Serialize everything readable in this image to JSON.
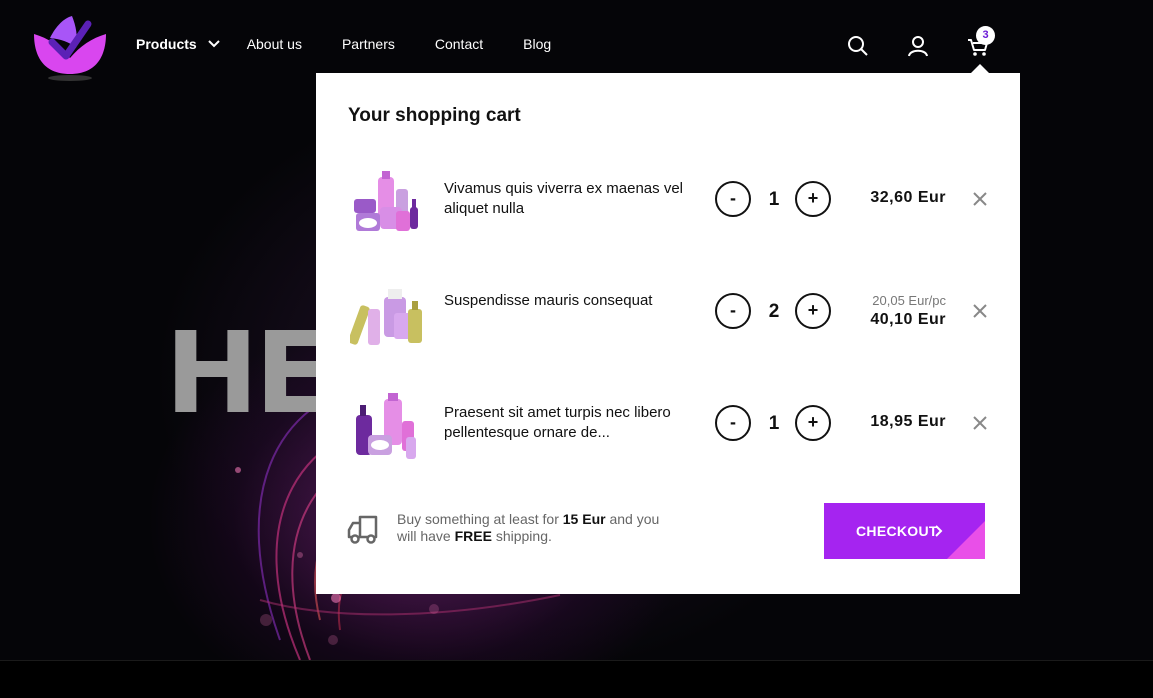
{
  "nav": {
    "items": [
      {
        "label": "Products"
      },
      {
        "label": "About us"
      },
      {
        "label": "Partners"
      },
      {
        "label": "Contact"
      },
      {
        "label": "Blog"
      }
    ]
  },
  "header": {
    "search_icon": "search-icon",
    "user_icon": "user-icon",
    "cart_icon": "cart-icon",
    "cart_count": "3"
  },
  "hero": {
    "text": "HE"
  },
  "cart": {
    "title": "Your shopping cart",
    "minus_label": "-",
    "plus_label": "+",
    "items": [
      {
        "name": "Vivamus quis viverra ex maenas vel aliquet nulla",
        "qty": "1",
        "unit_price": "",
        "price": "32,60 Eur"
      },
      {
        "name": "Suspendisse mauris consequat",
        "qty": "2",
        "unit_price": "20,05 Eur/pc",
        "price": "40,10 Eur"
      },
      {
        "name": "Praesent sit amet turpis nec libero pellentesque ornare de...",
        "qty": "1",
        "unit_price": "",
        "price": "18,95 Eur"
      }
    ],
    "shipping": {
      "prefix": "Buy something at least for",
      "amount": "15 Eur",
      "middle": "and you will have",
      "free": "FREE",
      "suffix": "shipping."
    },
    "checkout_label": "CHECKOUT"
  },
  "colors": {
    "accent": "#a524f0",
    "accent_corner": "#e94fe8",
    "logo_pink": "#d946ef",
    "logo_purple": "#7c3aed"
  }
}
